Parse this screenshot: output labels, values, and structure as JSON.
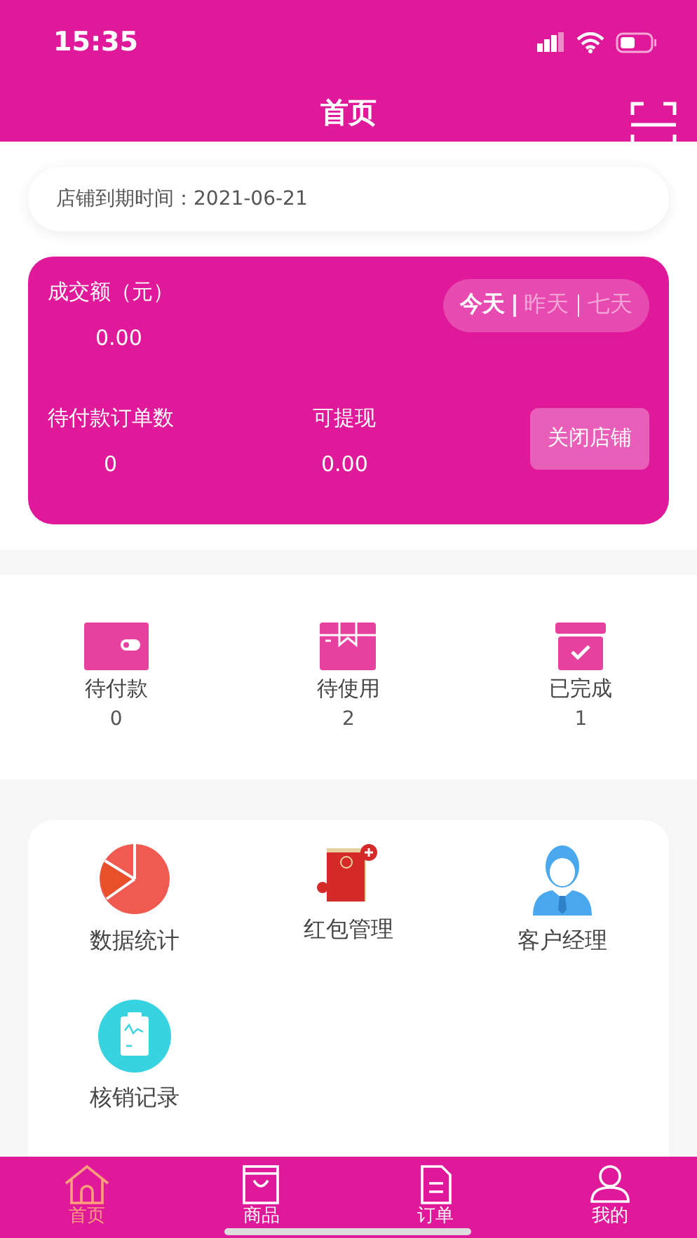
{
  "status_bar": {
    "time": "15:35"
  },
  "header": {
    "title": "首页"
  },
  "expiry": {
    "text": "店铺到期时间：2021-06-21"
  },
  "stats": {
    "title": "成交额（元）",
    "amount": "0.00",
    "periods": [
      {
        "label": "今天",
        "selected": true
      },
      {
        "label": "昨天",
        "selected": false
      },
      {
        "label": "七天",
        "selected": false
      }
    ],
    "pending_label": "待付款订单数",
    "pending_value": "0",
    "withdraw_label": "可提现",
    "withdraw_value": "0.00",
    "close_button": "关闭店铺"
  },
  "orders": [
    {
      "kind": "wallet",
      "label": "待付款",
      "count": "0"
    },
    {
      "kind": "box",
      "label": "待使用",
      "count": "2"
    },
    {
      "kind": "done",
      "label": "已完成",
      "count": "1"
    }
  ],
  "tools": [
    {
      "kind": "pie",
      "label": "数据统计"
    },
    {
      "kind": "envelope",
      "label": "红包管理"
    },
    {
      "kind": "manager",
      "label": "客户经理"
    },
    {
      "kind": "clipboard",
      "label": "核销记录"
    }
  ],
  "tab_bar": [
    {
      "kind": "home",
      "label": "首页",
      "selected": true
    },
    {
      "kind": "bag",
      "label": "商品",
      "selected": false
    },
    {
      "kind": "doc",
      "label": "订单",
      "selected": false
    },
    {
      "kind": "user",
      "label": "我的",
      "selected": false
    }
  ]
}
